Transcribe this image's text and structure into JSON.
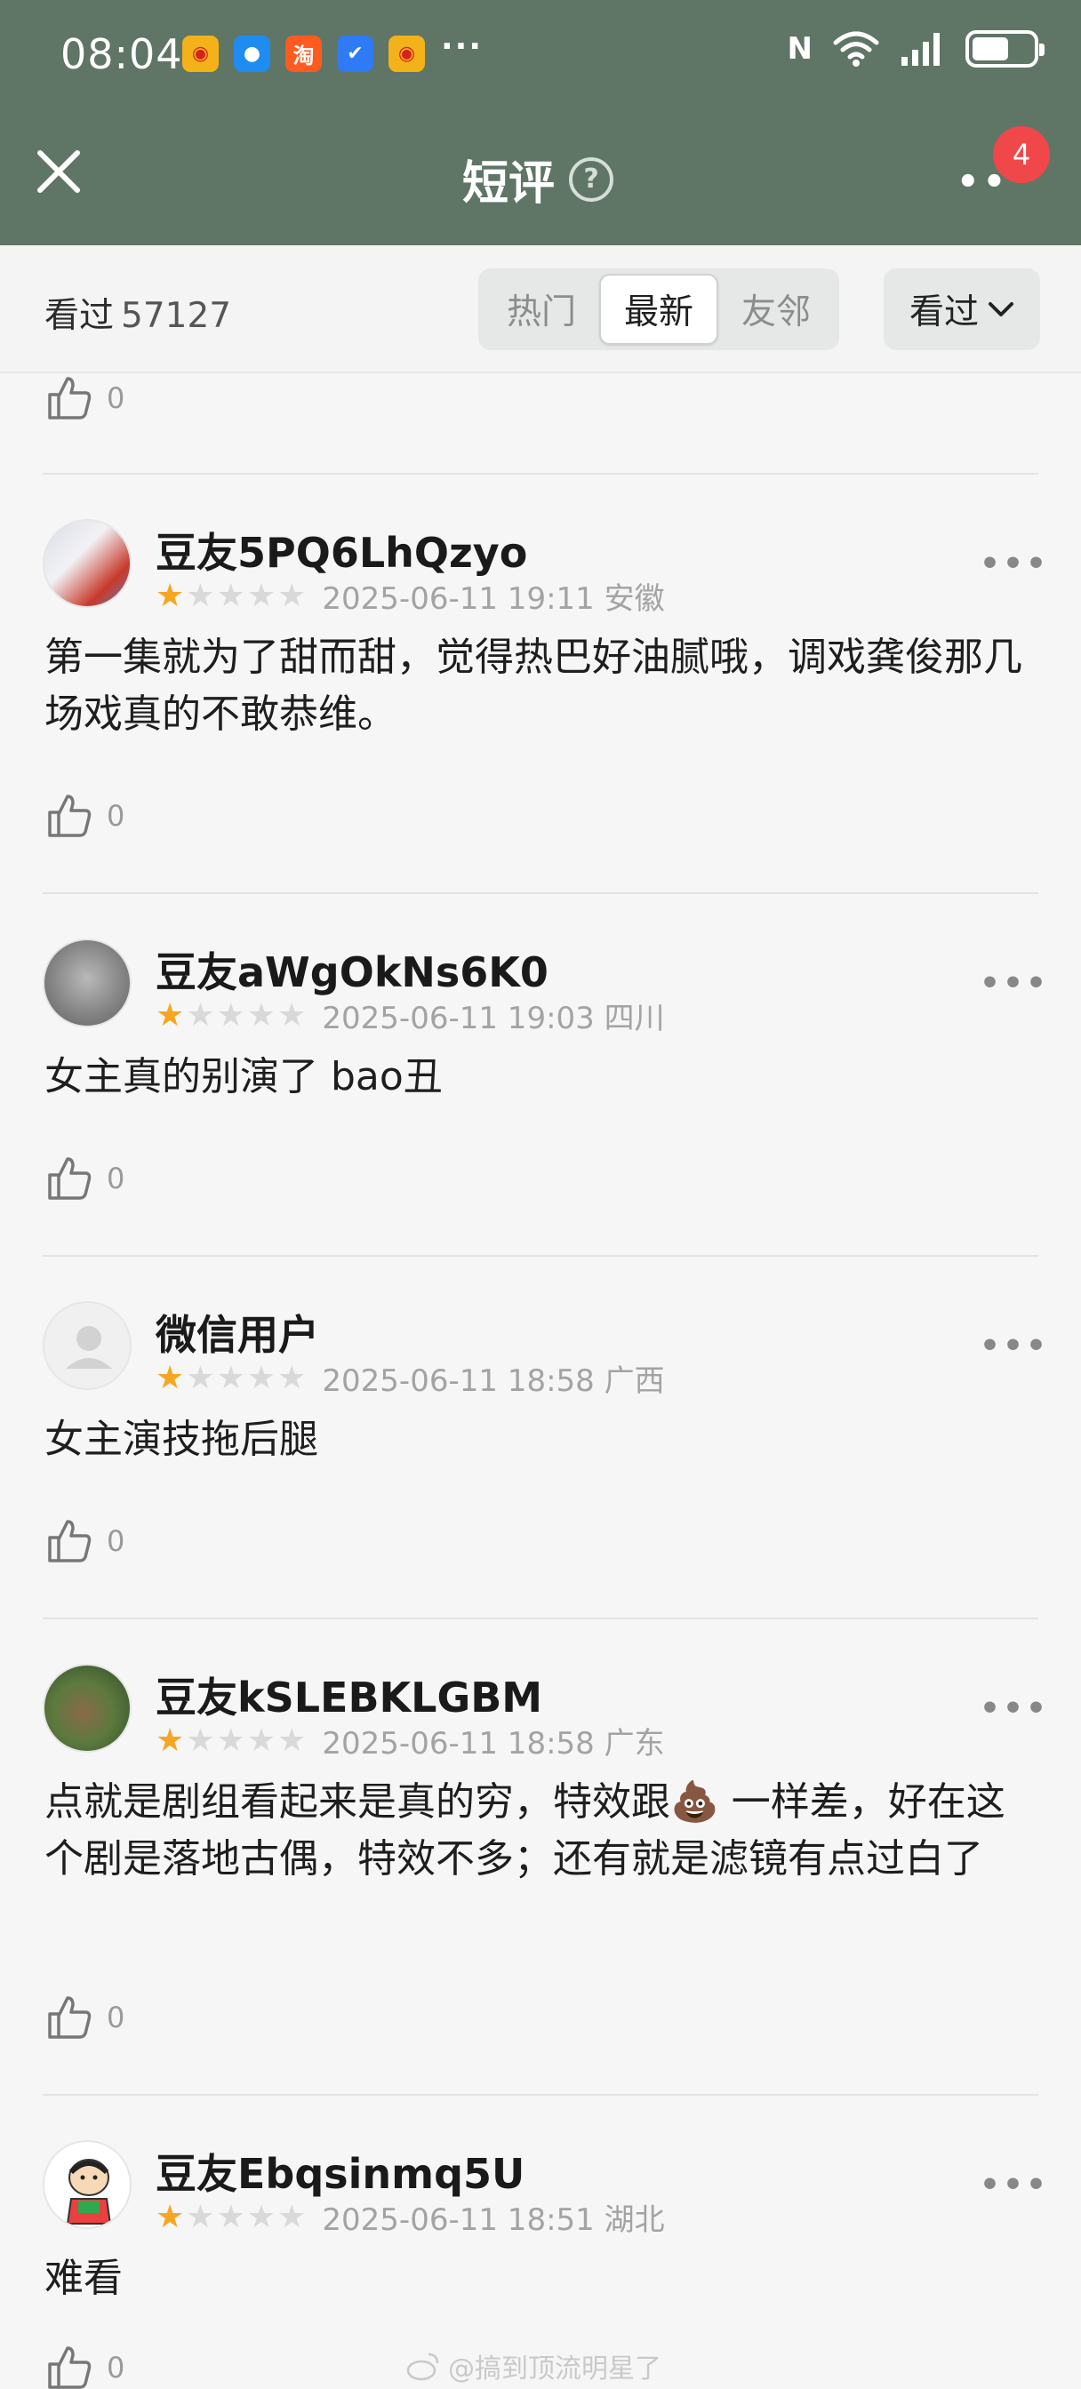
{
  "status_bar": {
    "time": "08:04",
    "overflow": "···",
    "apps": [
      {
        "icon": "weibo-lite-app-icon",
        "bg": "#f3b21a",
        "glyph": "◉"
      },
      {
        "icon": "message-app-icon",
        "bg": "#1e8cf0",
        "glyph": "●"
      },
      {
        "icon": "taobao-app-icon",
        "bg": "#ff5a1f",
        "glyph": "淘"
      },
      {
        "icon": "shield-app-icon",
        "bg": "#2f7bf5",
        "glyph": "✔"
      },
      {
        "icon": "weibo-app-icon",
        "bg": "#f3b21a",
        "glyph": "◉"
      }
    ]
  },
  "header": {
    "title": "短评",
    "help_glyph": "?",
    "badge_count": "4"
  },
  "filter": {
    "seen_label": "看过",
    "seen_count": "57127",
    "tabs": [
      {
        "label": "热门",
        "active": false
      },
      {
        "label": "最新",
        "active": true
      },
      {
        "label": "友邻",
        "active": false
      }
    ],
    "dropdown_label": "看过"
  },
  "top_like": {
    "count": "0"
  },
  "comments": [
    {
      "user": "豆友5PQ6LhQzyo",
      "rating": 1,
      "date": "2025-06-11 19:11 安徽",
      "text": "第一集就为了甜而甜，觉得热巴好油腻哦，调戏龚俊那几场戏真的不敢恭维。",
      "likes": "0",
      "avatar": "anime-avatar"
    },
    {
      "user": "豆友aWgOkNs6K0",
      "rating": 1,
      "date": "2025-06-11 19:03 四川",
      "text": "女主真的别演了 bao丑",
      "likes": "0",
      "avatar": "gray-avatar"
    },
    {
      "user": "微信用户",
      "rating": 1,
      "date": "2025-06-11 18:58 广西",
      "text": "女主演技拖后腿",
      "likes": "0",
      "avatar": "default-avatar"
    },
    {
      "user": "豆友kSLEBKLGBM",
      "rating": 1,
      "date": "2025-06-11 18:58 广东",
      "text": "点就是剧组看起来是真的穷，特效跟💩 一样差，好在这个剧是落地古偶，特效不多；还有就是滤镜有点过白了",
      "likes": "0",
      "avatar": "photo-avatar"
    },
    {
      "user": "豆友Ebqsinmq5U",
      "rating": 1,
      "date": "2025-06-11 18:51 湖北",
      "text": "难看",
      "likes": "0",
      "avatar": "cartoon-avatar"
    }
  ],
  "watermark": "@搞到顶流明星了"
}
